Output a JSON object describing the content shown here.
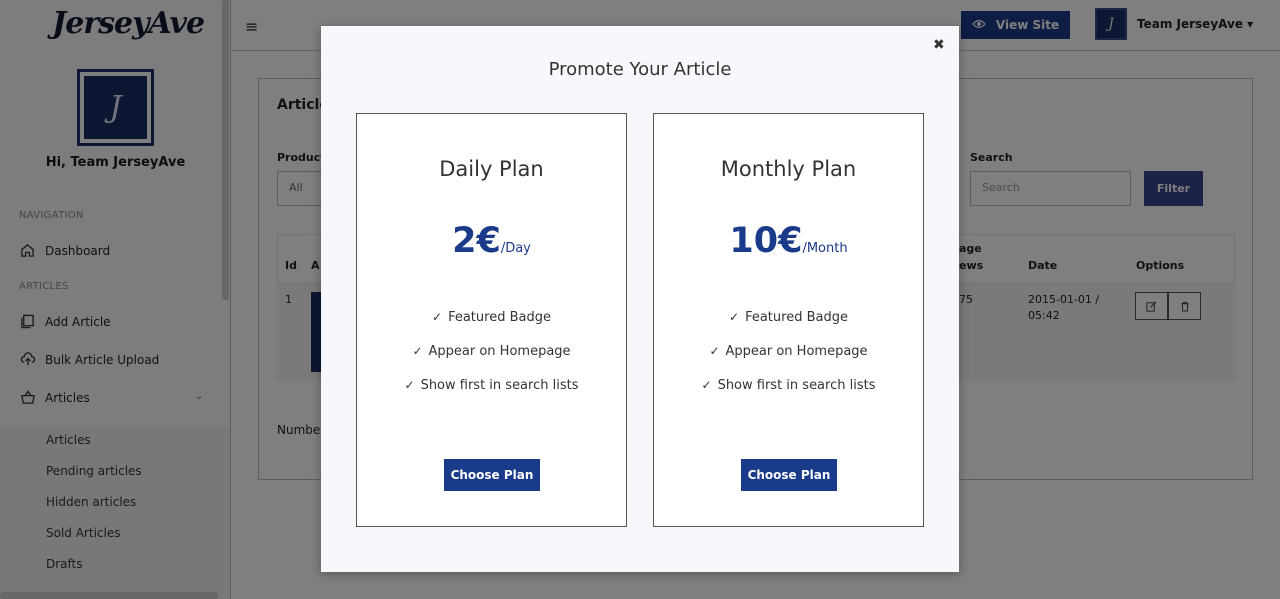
{
  "sidebar": {
    "logo": "JerseyAve",
    "avatar_letter": "J",
    "greeting": "Hi, Team JerseyAve",
    "navigation_label": "NAVIGATION",
    "dashboard": "Dashboard",
    "articles_label": "ARTICLES",
    "add_article": "Add Article",
    "bulk_upload": "Bulk Article Upload",
    "articles": "Articles",
    "sub": {
      "articles": "Articles",
      "pending": "Pending articles",
      "hidden": "Hidden articles",
      "sold": "Sold Articles",
      "drafts": "Drafts"
    }
  },
  "topbar": {
    "menu_icon": "≡",
    "view_site": "View Site",
    "user_letter": "J",
    "user_name": "Team JerseyAve ▾"
  },
  "panel": {
    "title": "Article",
    "product_label": "Product",
    "product_value": "All",
    "search_label": "Search",
    "search_placeholder": "Search",
    "filter": "Filter",
    "col_id": "Id",
    "col_a": "A",
    "col_views_1": "age",
    "col_views_2": "ews",
    "col_date": "Date",
    "col_options": "Options",
    "row_id": "1",
    "row_views": "75",
    "row_date_1": "2015-01-01 /",
    "row_date_2": "05:42",
    "numbered": "Numbe"
  },
  "modal": {
    "title": "Promote Your Article",
    "close": "✖",
    "plans": [
      {
        "name": "Daily Plan",
        "amount": "2€",
        "period": "/Day",
        "features": [
          "Featured Badge",
          "Appear on Homepage",
          "Show first in search lists"
        ],
        "cta": "Choose Plan"
      },
      {
        "name": "Monthly Plan",
        "amount": "10€",
        "period": "/Month",
        "features": [
          "Featured Badge",
          "Appear on Homepage",
          "Show first in search lists"
        ],
        "cta": "Choose Plan"
      }
    ]
  },
  "colors": {
    "brand": "#1a3a8a",
    "avatar": "#1a2e66",
    "filter": "#3b4790"
  },
  "icons": {
    "check": "check-icon",
    "eye": "eye-icon",
    "close": "close-icon"
  }
}
